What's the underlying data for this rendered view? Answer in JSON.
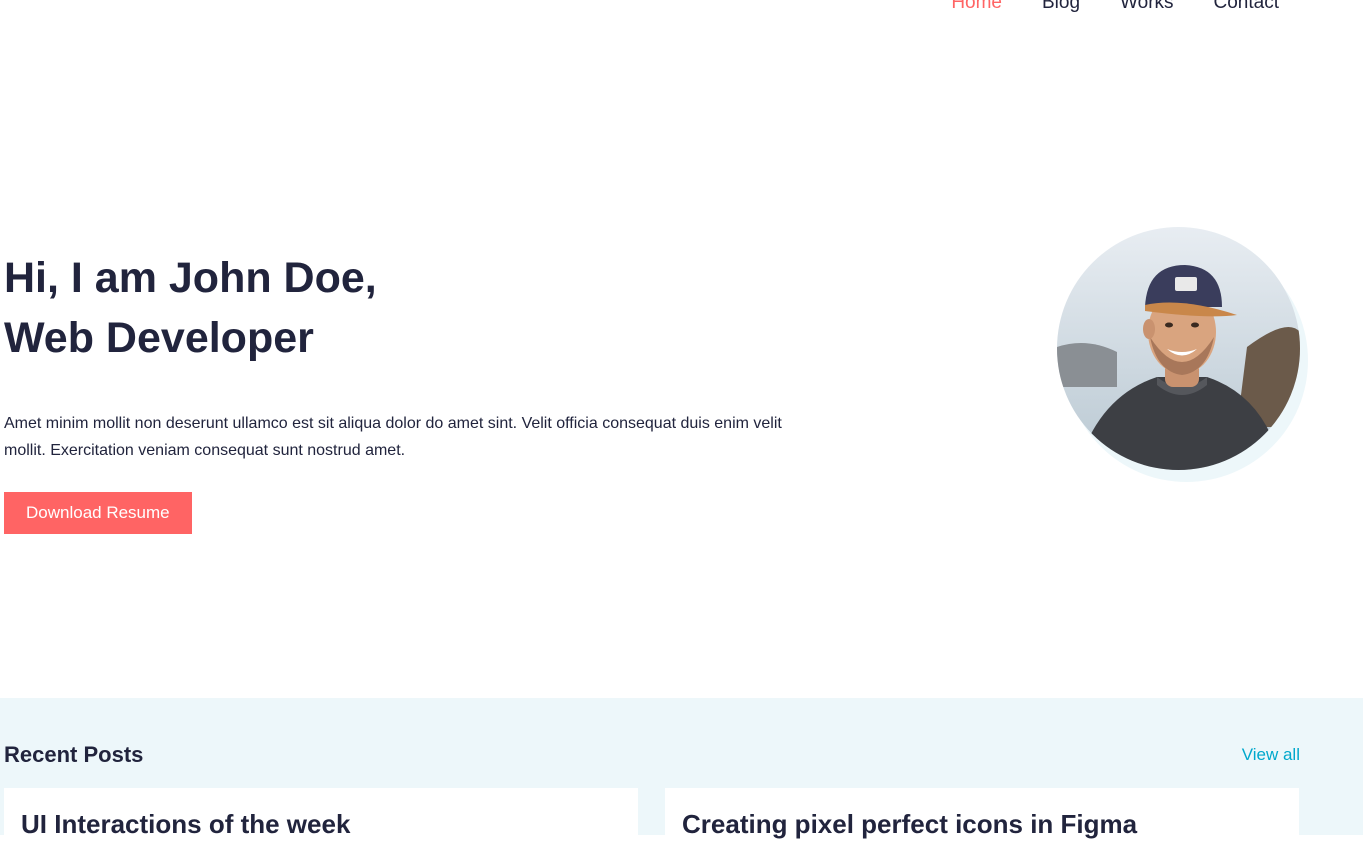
{
  "nav": {
    "items": [
      {
        "label": "Home",
        "active": true
      },
      {
        "label": "Blog",
        "active": false
      },
      {
        "label": "Works",
        "active": false
      },
      {
        "label": "Contact",
        "active": false
      }
    ]
  },
  "hero": {
    "title_line1": "Hi, I am John Doe,",
    "title_line2": "Web Developer",
    "description": "Amet minim mollit non deserunt ullamco est sit aliqua dolor do amet sint. Velit officia consequat duis enim velit mollit. Exercitation veniam consequat sunt nostrud amet.",
    "cta_label": "Download Resume"
  },
  "posts": {
    "heading": "Recent Posts",
    "view_all": "View all",
    "cards": [
      {
        "title": "UI Interactions of the week"
      },
      {
        "title": "Creating pixel perfect icons in Figma"
      }
    ]
  },
  "colors": {
    "accent": "#FF6464",
    "link": "#00A8CC",
    "text": "#21243D",
    "section_bg": "#EDF7FA"
  }
}
